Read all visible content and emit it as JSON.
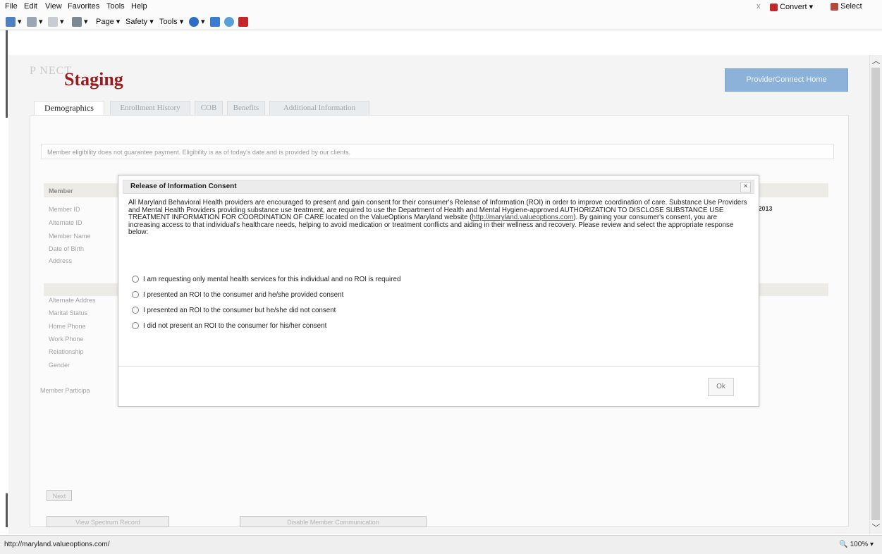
{
  "browser": {
    "menu": [
      "File",
      "Edit",
      "View",
      "Favorites",
      "Tools",
      "Help"
    ],
    "toolbar": {
      "page": "Page ▾",
      "safety": "Safety ▾",
      "tools": "Tools ▾"
    },
    "convert": "Convert ▾",
    "select": "Select",
    "close": "x",
    "status_url": "http://maryland.valueoptions.com/",
    "zoom": "100%"
  },
  "page": {
    "brand_fragment": "P          NECT",
    "staging": "Staging",
    "home_button": "ProviderConnect Home",
    "tabs": [
      "Demographics",
      "Enrollment History",
      "COB",
      "Benefits",
      "Additional Information"
    ],
    "notice": "Member eligibility does not guarantee payment. Eligibility is as of today's date and is provided by our clients.",
    "member_header": "Member",
    "labels": [
      "Member ID",
      "Alternate ID",
      "Member Name",
      "Date of Birth",
      "Address",
      "Alternate Addres",
      "Marital Status",
      "Home Phone",
      "Work Phone",
      "Relationship",
      "Gender"
    ],
    "member_participation": "Member Participa",
    "date_fragment": "/2013",
    "next_button": "Next",
    "view_spectrum_button": "View Spectrum Record",
    "disable_comm_button": "Disable Member Communication"
  },
  "modal": {
    "title": "Release of Information Consent",
    "close": "×",
    "body_before_link": "All Maryland Behavioral Health providers are encouraged to present and gain consent for their consumer's Release of Information (ROI) in order to improve coordination of care. Substance Use Providers and Mental Health Providers providing substance use treatment, are required to use the Department of Health and Mental Hygiene-approved AUTHORIZATION TO DISCLOSE SUBSTANCE USE TREATMENT INFORMATION FOR COORDINATION OF CARE located on the ValueOptions Maryland website (",
    "link": "http://maryland.valueoptions.com",
    "body_after_link": "). By gaining your consumer's consent, you are increasing access to that individual's healthcare needs, helping to avoid medication or treatment conflicts and aiding in their wellness and recovery. Please review and select the appropriate response below:",
    "options": [
      "I am requesting only mental health services for this individual and no ROI is required",
      "I presented an ROI to the consumer and he/she provided consent",
      "I presented an ROI to the consumer but he/she did not consent",
      "I did not present an ROI to the consumer for his/her consent"
    ],
    "ok": "Ok"
  }
}
